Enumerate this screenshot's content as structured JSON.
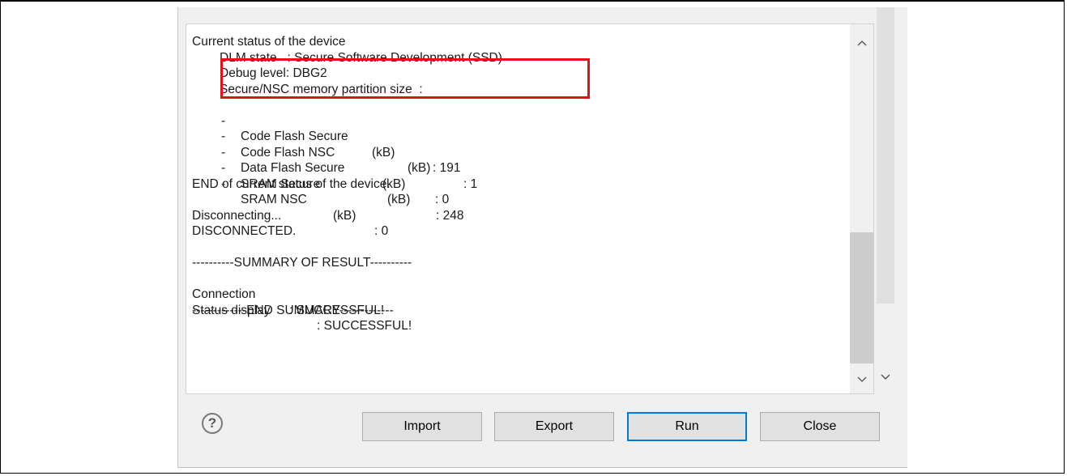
{
  "console": {
    "lines": {
      "l0": "Current status of the device",
      "l1": "DLM state   : Secure Software Development (SSD)",
      "l2": "Debug level: DBG2",
      "l3": "Secure/NSC memory partition size  :",
      "l9": "END of current status of the device.",
      "l11": "Disconnecting...",
      "l12": "DISCONNECTED.",
      "l14": "----------SUMMARY OF RESULT----------",
      "l17": "-------------END SUMMARY-------------"
    },
    "partitions": [
      {
        "label": "Code Flash Secure",
        "unit": "(kB)",
        "value": ": 191"
      },
      {
        "label": "Code Flash NSC",
        "unit": "(kB)",
        "value": ": 1"
      },
      {
        "label": "Data Flash Secure",
        "unit": "(kB)",
        "value": ": 0"
      },
      {
        "label": "SRAM Secure",
        "unit": "(kB)",
        "value": ": 248"
      },
      {
        "label": "SRAM NSC",
        "unit": "(kB)",
        "value": ": 0"
      }
    ],
    "dash": "-",
    "summary": [
      {
        "label": "Connection",
        "value": ": SUCCESSFUL!"
      },
      {
        "label": "Status display",
        "value": ": SUCCESSFUL!"
      }
    ]
  },
  "buttons": {
    "import": "Import",
    "export": "Export",
    "run": "Run",
    "close": "Close"
  },
  "icons": {
    "help": "?",
    "scroll_up": "^",
    "scroll_down": "v"
  },
  "colors": {
    "highlight": "#e0121b",
    "default_button_border": "#0078d7"
  }
}
